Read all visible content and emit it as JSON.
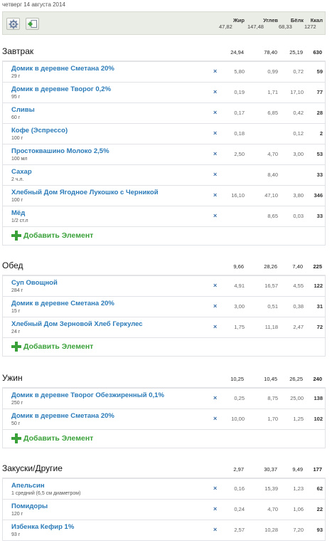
{
  "date": "четверг 14 августа 2014",
  "toolbar": {
    "settings_icon": "gear-icon",
    "add_icon": "add-page-icon"
  },
  "columns": [
    {
      "key": "fat",
      "label": "Жир",
      "total": "47,82"
    },
    {
      "key": "carb",
      "label": "Углев",
      "total": "147,48"
    },
    {
      "key": "prot",
      "label": "Бёлк",
      "total": "68,33"
    },
    {
      "key": "kcal",
      "label": "Ккал",
      "total": "1272"
    }
  ],
  "add_label": "Добавить Элемент",
  "meals": [
    {
      "title": "Завтрак",
      "totals": {
        "fat": "24,94",
        "carb": "78,40",
        "prot": "25,19",
        "kcal": "630"
      },
      "items": [
        {
          "name": "Домик в деревне Сметана 20%",
          "portion": "29 г",
          "fat": "5,80",
          "carb": "0,99",
          "prot": "0,72",
          "kcal": "59"
        },
        {
          "name": "Домик в деревне Творог 0,2%",
          "portion": "95 г",
          "fat": "0,19",
          "carb": "1,71",
          "prot": "17,10",
          "kcal": "77"
        },
        {
          "name": "Сливы",
          "portion": "60 г",
          "fat": "0,17",
          "carb": "6,85",
          "prot": "0,42",
          "kcal": "28"
        },
        {
          "name": "Кофе (Эспрессо)",
          "portion": "100 г",
          "fat": "0,18",
          "carb": "",
          "prot": "0,12",
          "kcal": "2"
        },
        {
          "name": "Простоквашино Молоко 2,5%",
          "portion": "100 мл",
          "fat": "2,50",
          "carb": "4,70",
          "prot": "3,00",
          "kcal": "53"
        },
        {
          "name": "Сахар",
          "portion": "2 ч.л.",
          "fat": "",
          "carb": "8,40",
          "prot": "",
          "kcal": "33"
        },
        {
          "name": "Хлебный Дом Ягодное Лукошко с Черникой",
          "portion": "100 г",
          "fat": "16,10",
          "carb": "47,10",
          "prot": "3,80",
          "kcal": "346"
        },
        {
          "name": "Мёд",
          "portion": "1/2 ст.л",
          "fat": "",
          "carb": "8,65",
          "prot": "0,03",
          "kcal": "33"
        }
      ]
    },
    {
      "title": "Обед",
      "totals": {
        "fat": "9,66",
        "carb": "28,26",
        "prot": "7,40",
        "kcal": "225"
      },
      "items": [
        {
          "name": "Суп Овощной",
          "portion": "284 г",
          "fat": "4,91",
          "carb": "16,57",
          "prot": "4,55",
          "kcal": "122"
        },
        {
          "name": "Домик в деревне Сметана 20%",
          "portion": "15 г",
          "fat": "3,00",
          "carb": "0,51",
          "prot": "0,38",
          "kcal": "31"
        },
        {
          "name": "Хлебный Дом Зерновой Хлеб Геркулес",
          "portion": "24 г",
          "fat": "1,75",
          "carb": "11,18",
          "prot": "2,47",
          "kcal": "72"
        }
      ]
    },
    {
      "title": "Ужин",
      "totals": {
        "fat": "10,25",
        "carb": "10,45",
        "prot": "26,25",
        "kcal": "240"
      },
      "items": [
        {
          "name": "Домик в деревне Творог Обезжиренный 0,1%",
          "portion": "250 г",
          "fat": "0,25",
          "carb": "8,75",
          "prot": "25,00",
          "kcal": "138"
        },
        {
          "name": "Домик в деревне Сметана 20%",
          "portion": "50 г",
          "fat": "10,00",
          "carb": "1,70",
          "prot": "1,25",
          "kcal": "102"
        }
      ]
    },
    {
      "title": "Закуски/Другие",
      "totals": {
        "fat": "2,97",
        "carb": "30,37",
        "prot": "9,49",
        "kcal": "177"
      },
      "items": [
        {
          "name": "Апельсин",
          "portion": "1 средний (6,5 см диаметром)",
          "fat": "0,16",
          "carb": "15,39",
          "prot": "1,23",
          "kcal": "62"
        },
        {
          "name": "Помидоры",
          "portion": "120 г",
          "fat": "0,24",
          "carb": "4,70",
          "prot": "1,06",
          "kcal": "22"
        },
        {
          "name": "Избенка Кефир 1%",
          "portion": "93 г",
          "fat": "2,57",
          "carb": "10,28",
          "prot": "7,20",
          "kcal": "93"
        }
      ]
    }
  ]
}
